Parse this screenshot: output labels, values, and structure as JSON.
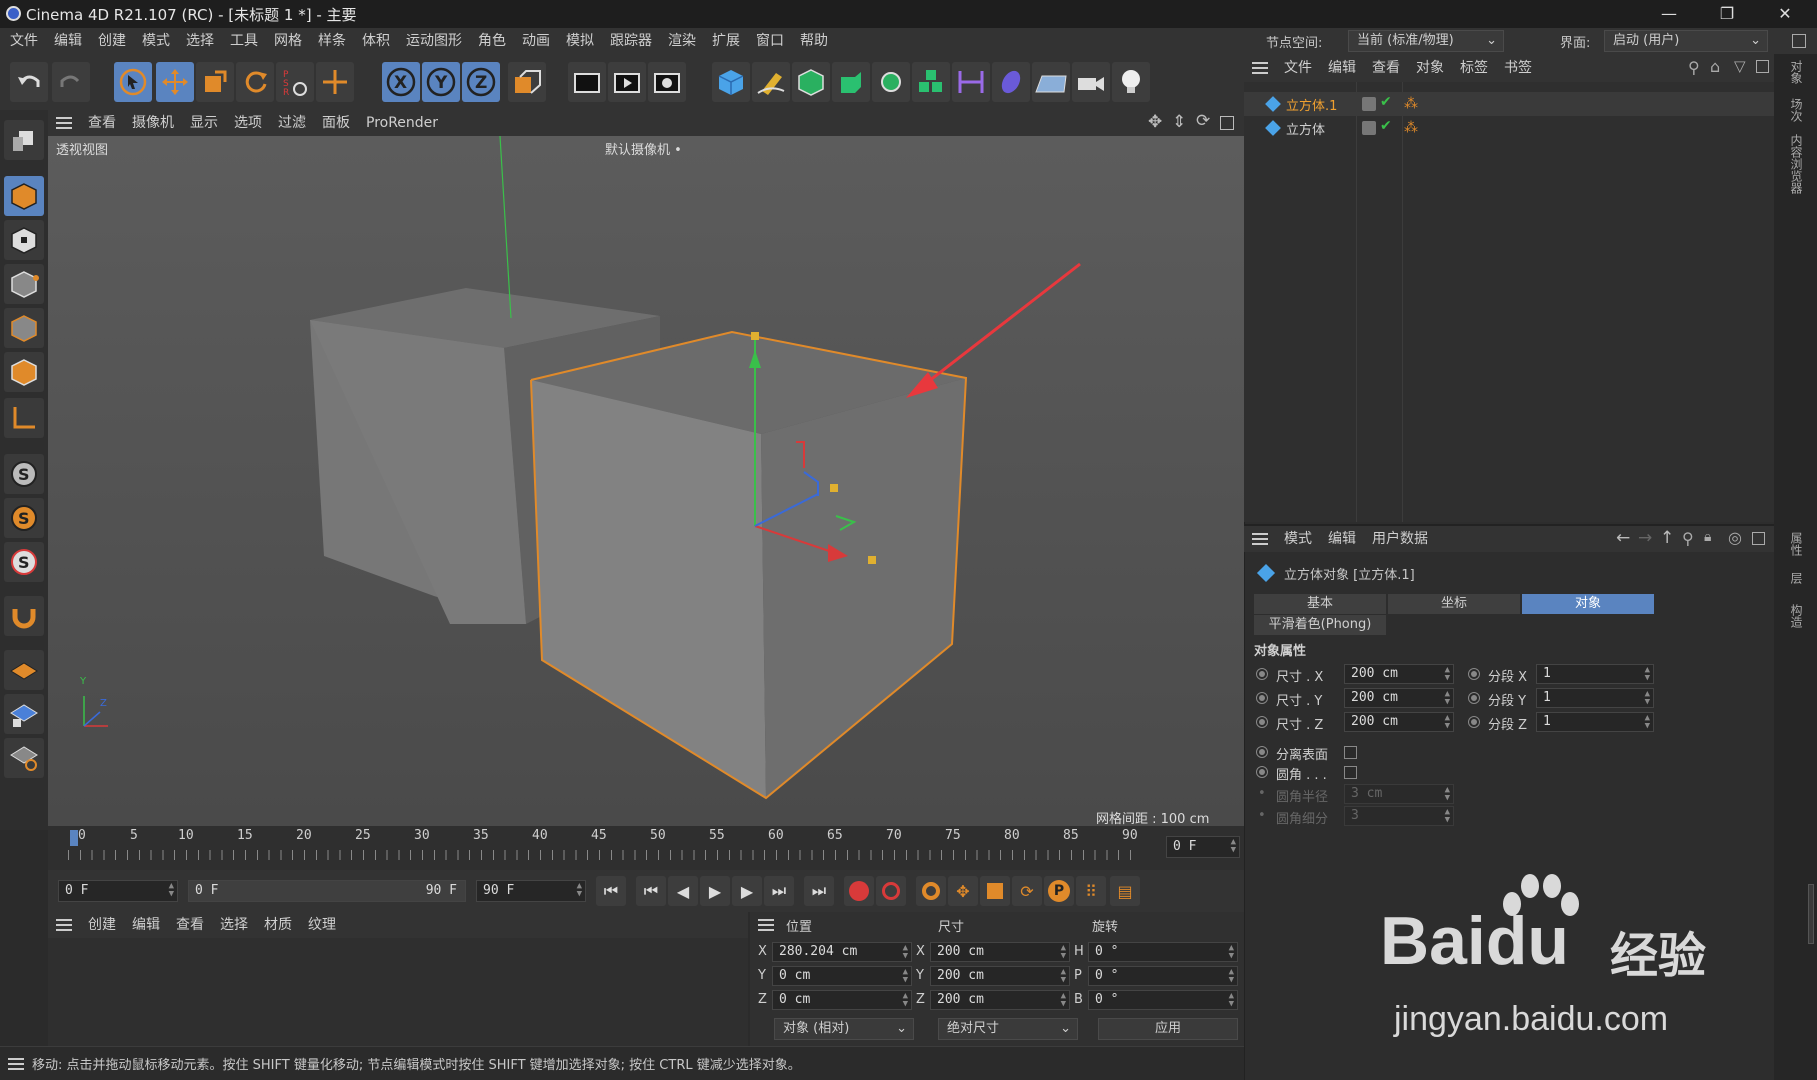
{
  "window": {
    "title": "Cinema 4D R21.107 (RC) - [未标题 1 *] - 主要",
    "min_icon": "—",
    "max_icon": "❐",
    "close_icon": "✕"
  },
  "menu": [
    "文件",
    "编辑",
    "创建",
    "模式",
    "选择",
    "工具",
    "网格",
    "样条",
    "体积",
    "运动图形",
    "角色",
    "动画",
    "模拟",
    "跟踪器",
    "渲染",
    "扩展",
    "窗口",
    "帮助"
  ],
  "node_space": {
    "label": "节点空间:",
    "value": "当前 (标准/物理)"
  },
  "layout": {
    "label": "界面:",
    "value": "启动 (用户)"
  },
  "viewport": {
    "menu": [
      "查看",
      "摄像机",
      "显示",
      "选项",
      "过滤",
      "面板",
      "ProRender"
    ],
    "view_name": "透视视图",
    "camera_name": "默认摄像机",
    "grid_spacing": "网格间距 : 100 cm",
    "axis_y": "Y",
    "axis_z": "Z"
  },
  "timeline": {
    "ticks": [
      "0",
      "5",
      "10",
      "15",
      "20",
      "25",
      "30",
      "35",
      "40",
      "45",
      "50",
      "55",
      "60",
      "65",
      "70",
      "75",
      "80",
      "85",
      "90"
    ],
    "current_frame": "0 F"
  },
  "transport": {
    "start": "0 F",
    "range_start": "0 F",
    "range_end": "90 F",
    "end": "90 F"
  },
  "materials": {
    "menu": [
      "创建",
      "编辑",
      "查看",
      "选择",
      "材质",
      "纹理"
    ]
  },
  "coordinates": {
    "headers": {
      "position": "位置",
      "size": "尺寸",
      "rotation": "旋转"
    },
    "rows": [
      {
        "axis": "X",
        "pos": "280.204 cm",
        "size_axis": "X",
        "size": "200 cm",
        "rot_axis": "H",
        "rot": "0 °"
      },
      {
        "axis": "Y",
        "pos": "0 cm",
        "size_axis": "Y",
        "size": "200 cm",
        "rot_axis": "P",
        "rot": "0 °"
      },
      {
        "axis": "Z",
        "pos": "0 cm",
        "size_axis": "Z",
        "size": "200 cm",
        "rot_axis": "B",
        "rot": "0 °"
      }
    ],
    "mode": "对象 (相对)",
    "size_mode": "绝对尺寸",
    "apply": "应用"
  },
  "status": "移动: 点击并拖动鼠标移动元素。按住 SHIFT 键量化移动; 节点编辑模式时按住 SHIFT 键增加选择对象; 按住 CTRL 键减少选择对象。",
  "object_manager": {
    "menu": [
      "文件",
      "编辑",
      "查看",
      "对象",
      "标签",
      "书签"
    ],
    "objects": [
      {
        "name": "立方体.1",
        "selected": true
      },
      {
        "name": "立方体",
        "selected": false
      }
    ]
  },
  "attributes": {
    "menu": [
      "模式",
      "编辑",
      "用户数据"
    ],
    "object_title": "立方体对象 [立方体.1]",
    "tabs": [
      "基本",
      "坐标",
      "对象"
    ],
    "active_tab": 2,
    "phong_tab": "平滑着色(Phong)",
    "section": "对象属性",
    "size_x_label": "尺寸 . X",
    "size_x": "200 cm",
    "size_y_label": "尺寸 . Y",
    "size_y": "200 cm",
    "size_z_label": "尺寸 . Z",
    "size_z": "200 cm",
    "seg_x_label": "分段 X",
    "seg_x": "1",
    "seg_y_label": "分段 Y",
    "seg_y": "1",
    "seg_z_label": "分段 Z",
    "seg_z": "1",
    "separate_label": "分离表面",
    "fillet_label": "圆角 . . .",
    "fillet_radius_label": "圆角半径",
    "fillet_radius": "3 cm",
    "fillet_sub_label": "圆角细分",
    "fillet_sub": "3"
  },
  "side_tabs": [
    "对象",
    "场次",
    "内容浏览器"
  ],
  "side_tabs_lower": [
    "属性",
    "层",
    "构造"
  ],
  "watermark": {
    "brand": "Bai",
    "brand2": "du",
    "text": "经验",
    "url": "jingyan.baidu.com"
  },
  "colors": {
    "accent": "#5a84c0",
    "selection": "#e08a2a",
    "arrow": "#e8383d",
    "axis_x": "#d83a3a",
    "axis_y": "#3ac04a",
    "axis_z": "#3a6ad8"
  }
}
